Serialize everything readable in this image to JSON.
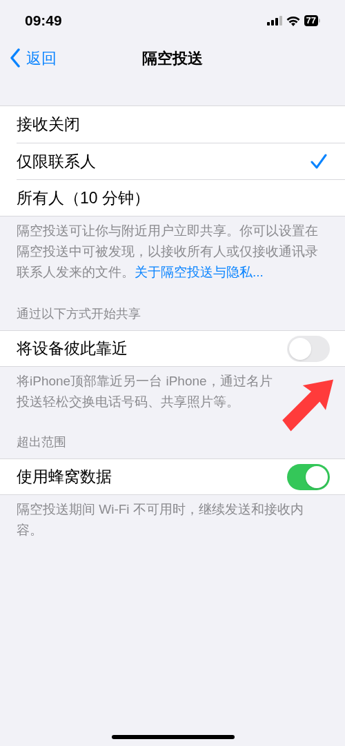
{
  "status_bar": {
    "time": "09:49",
    "battery": "77"
  },
  "nav": {
    "back": "返回",
    "title": "隔空投送"
  },
  "receive_options": [
    {
      "label": "接收关闭",
      "selected": false
    },
    {
      "label": "仅限联系人",
      "selected": true
    },
    {
      "label": "所有人（10 分钟）",
      "selected": false
    }
  ],
  "receive_footer": {
    "text": "隔空投送可让你与附近用户立即共享。你可以设置在隔空投送中可被发现，以接收所有人或仅接收通讯录联系人发来的文件。",
    "link": "关于隔空投送与隐私..."
  },
  "sections": [
    {
      "header": "通过以下方式开始共享",
      "row": {
        "label": "将设备彼此靠近",
        "on": false
      },
      "footer": "将iPhone顶部靠近另一台 iPhone，通过名片投送轻松交换电话号码、共享照片等。"
    },
    {
      "header": "超出范围",
      "row": {
        "label": "使用蜂窝数据",
        "on": true
      },
      "footer": "隔空投送期间 Wi-Fi 不可用时，继续发送和接收内容。"
    }
  ]
}
